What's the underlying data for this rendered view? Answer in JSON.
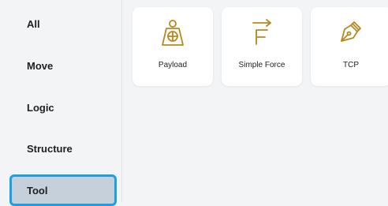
{
  "sidebar": {
    "items": [
      {
        "label": "All"
      },
      {
        "label": "Move"
      },
      {
        "label": "Logic"
      },
      {
        "label": "Structure"
      },
      {
        "label": "Tool"
      }
    ],
    "selected": "Tool"
  },
  "cards": [
    {
      "label": "Payload",
      "icon": "payload-weight-icon"
    },
    {
      "label": "Simple Force",
      "icon": "force-vector-icon"
    },
    {
      "label": "TCP",
      "icon": "pen-nib-icon"
    }
  ],
  "colors": {
    "accent_icon": "#b5891e",
    "selected_border": "#19a0e6",
    "selected_fill": "#c5d0db"
  }
}
